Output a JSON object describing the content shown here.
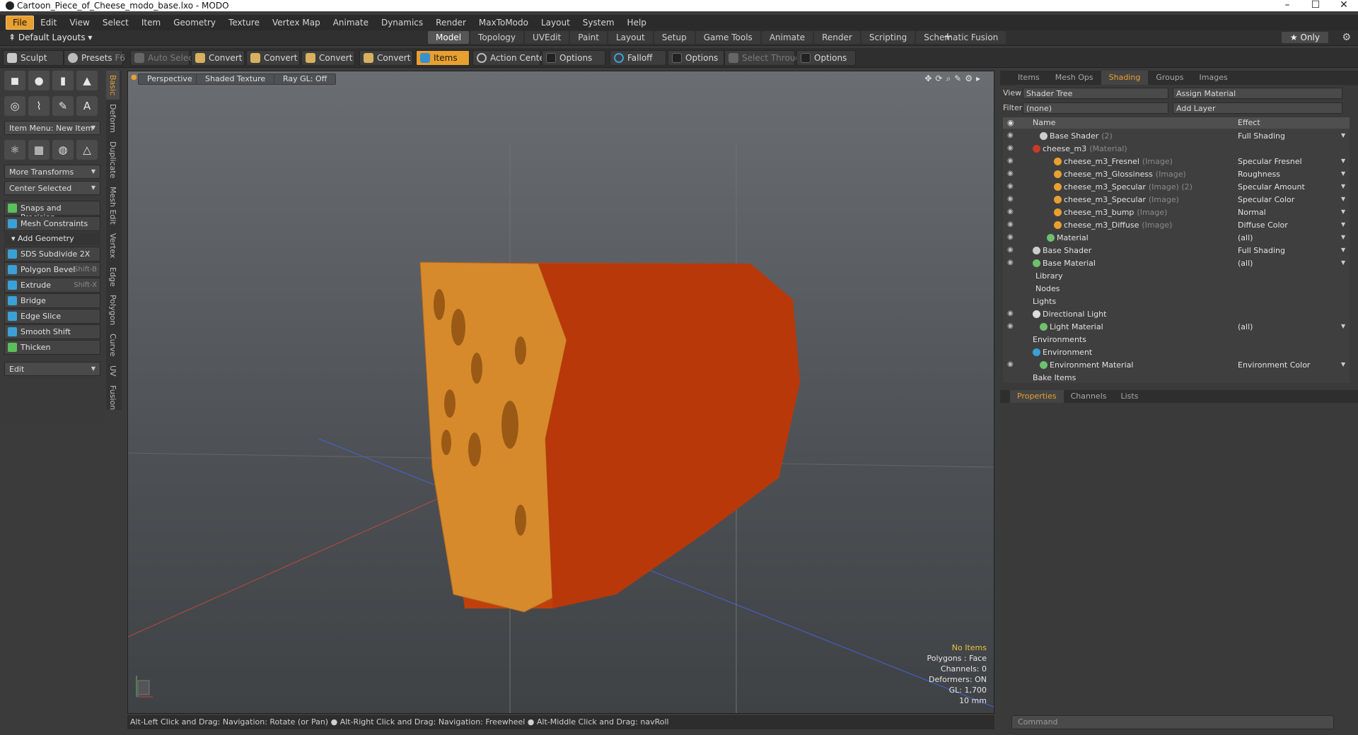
{
  "window": {
    "title": "Cartoon_Piece_of_Cheese_modo_base.lxo - MODO"
  },
  "menu": [
    "File",
    "Edit",
    "View",
    "Select",
    "Item",
    "Geometry",
    "Texture",
    "Vertex Map",
    "Animate",
    "Dynamics",
    "Render",
    "MaxToModo",
    "Layout",
    "System",
    "Help"
  ],
  "layout": {
    "preset": "Default Layouts",
    "tabs": [
      "Model",
      "Topology",
      "UVEdit",
      "Paint",
      "Layout",
      "Setup",
      "Game Tools",
      "Animate",
      "Render",
      "Scripting",
      "Schematic Fusion"
    ],
    "selected": "Model",
    "only": "Only"
  },
  "toolbar": {
    "sculpt": "Sculpt",
    "presets": "Presets",
    "presets_key": "F6",
    "auto_select": "Auto Select",
    "convert1": "Convert",
    "convert2": "Convert",
    "convert3": "Convert",
    "convert4": "Convert",
    "items": "Items",
    "action_center": "Action Center",
    "options1": "Options",
    "falloff": "Falloff",
    "options2": "Options",
    "select_through": "Select Through",
    "options3": "Options"
  },
  "left": {
    "item_menu": "Item Menu: New Item",
    "more_transforms": "More Transforms",
    "center_selected": "Center Selected",
    "snaps": "Snaps and Precision",
    "constraints": "Mesh Constraints",
    "add_geometry": "Add Geometry",
    "tools": [
      {
        "label": "SDS Subdivide 2X",
        "key": ""
      },
      {
        "label": "Polygon Bevel",
        "key": "Shift-B"
      },
      {
        "label": "Extrude",
        "key": "Shift-X"
      },
      {
        "label": "Bridge",
        "key": ""
      },
      {
        "label": "Edge Slice",
        "key": ""
      },
      {
        "label": "Smooth Shift",
        "key": ""
      },
      {
        "label": "Thicken",
        "key": ""
      }
    ],
    "edit": "Edit",
    "side_tabs": [
      "Basic",
      "Deform",
      "Duplicate",
      "Mesh Edit",
      "Vertex",
      "Edge",
      "Polygon",
      "Curve",
      "UV",
      "Fusion"
    ]
  },
  "viewport": {
    "perspective": "Perspective",
    "shading": "Shaded Texture",
    "raygl": "Ray GL: Off",
    "info": {
      "no_items": "No Items",
      "polygons": "Polygons : Face",
      "channels": "Channels: 0",
      "deformers": "Deformers: ON",
      "gl": "GL: 1,700",
      "scale": "10 mm"
    }
  },
  "status": "Alt-Left Click and Drag: Navigation: Rotate (or Pan) ● Alt-Right Click and Drag: Navigation: Freewheel ● Alt-Middle Click and Drag: navRoll",
  "right": {
    "tabs": [
      "Items",
      "Mesh Ops",
      "Shading",
      "Groups",
      "Images"
    ],
    "selected_tab": "Shading",
    "view_label": "View",
    "view_value": "Shader Tree",
    "assign_material": "Assign Material",
    "filter_label": "Filter",
    "filter_value": "(none)",
    "add_layer": "Add Layer",
    "col_name": "Name",
    "col_effect": "Effect",
    "rows": [
      {
        "name": "Base Shader",
        "type": "(2)",
        "effect": "Full Shading"
      },
      {
        "name": "cheese_m3",
        "type": "(Material)",
        "effect": ""
      },
      {
        "name": "cheese_m3_Fresnel",
        "type": "(Image)",
        "effect": "Specular Fresnel"
      },
      {
        "name": "cheese_m3_Glossiness",
        "type": "(Image)",
        "effect": "Roughness"
      },
      {
        "name": "cheese_m3_Specular",
        "type": "(Image) (2)",
        "effect": "Specular Amount"
      },
      {
        "name": "cheese_m3_Specular",
        "type": "(Image)",
        "effect": "Specular Color"
      },
      {
        "name": "cheese_m3_bump",
        "type": "(Image)",
        "effect": "Normal"
      },
      {
        "name": "cheese_m3_Diffuse",
        "type": "(Image)",
        "effect": "Diffuse Color"
      },
      {
        "name": "Material",
        "type": "",
        "effect": "(all)"
      },
      {
        "name": "Base Shader",
        "type": "",
        "effect": "Full Shading"
      },
      {
        "name": "Base Material",
        "type": "",
        "effect": "(all)"
      },
      {
        "name": "Library",
        "type": "",
        "effect": ""
      },
      {
        "name": "Nodes",
        "type": "",
        "effect": ""
      },
      {
        "name": "Lights",
        "type": "",
        "effect": ""
      },
      {
        "name": "Directional Light",
        "type": "",
        "effect": ""
      },
      {
        "name": "Light Material",
        "type": "",
        "effect": "(all)"
      },
      {
        "name": "Environments",
        "type": "",
        "effect": ""
      },
      {
        "name": "Environment",
        "type": "",
        "effect": ""
      },
      {
        "name": "Environment Material",
        "type": "",
        "effect": "Environment Color"
      },
      {
        "name": "Bake Items",
        "type": "",
        "effect": ""
      }
    ],
    "prop_tabs": [
      "Properties",
      "Channels",
      "Lists"
    ],
    "command_placeholder": "Command"
  },
  "colors": {
    "accent": "#e8a030",
    "cheese": "#c8420c",
    "cheese_face": "#d98a2a"
  }
}
